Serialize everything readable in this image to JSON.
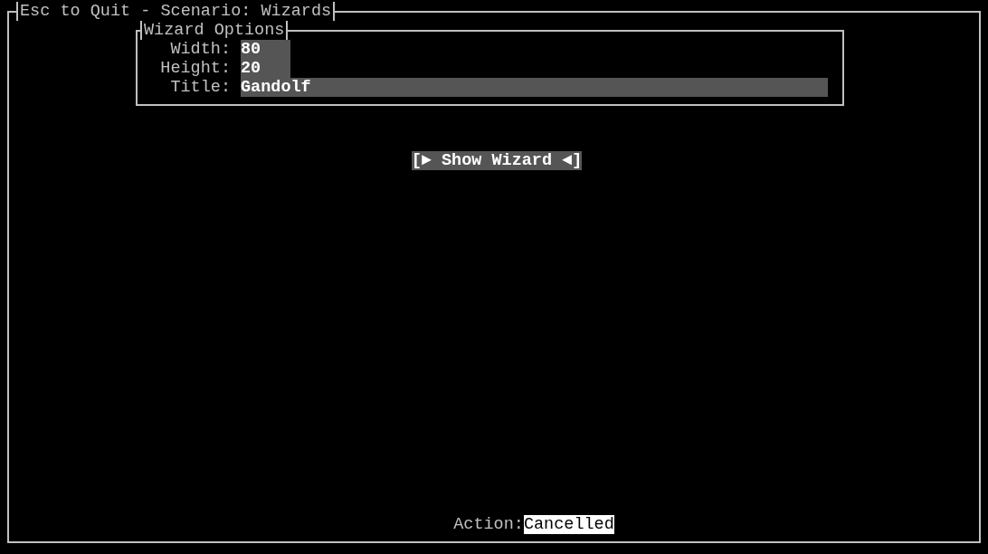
{
  "window": {
    "title": "Esc to Quit - Scenario: Wizards"
  },
  "options": {
    "title": "Wizard Options",
    "fields": [
      {
        "label": "Width:",
        "value": "80",
        "wide": false
      },
      {
        "label": "Height:",
        "value": "20",
        "wide": false
      },
      {
        "label": "Title:",
        "value": "Gandolf",
        "wide": true
      }
    ]
  },
  "button": {
    "label": "[► Show Wizard ◄]",
    "focused": true
  },
  "status": {
    "label": "Action:",
    "value": "Cancelled"
  }
}
